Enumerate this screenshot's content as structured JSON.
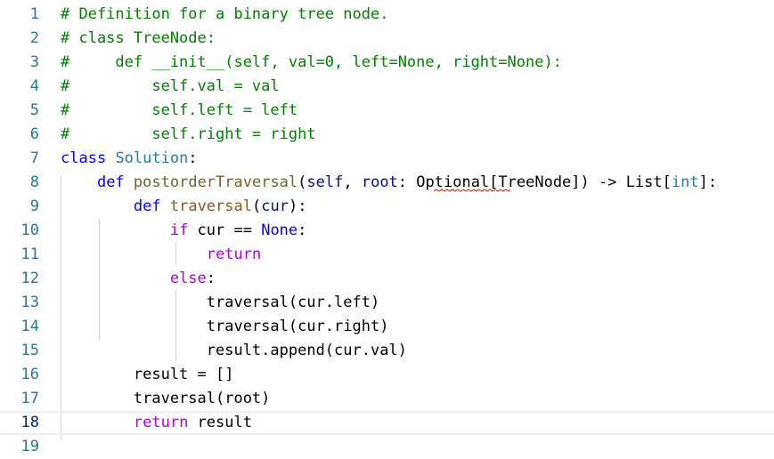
{
  "editor": {
    "language": "python",
    "active_line": 18,
    "colors": {
      "comment": "#008000",
      "keyword": "#0000ff",
      "control_flow": "#af00db",
      "default": "#000000",
      "class": "#267f99",
      "function": "#795e26",
      "parameter": "#001080",
      "line_number": "#237893"
    },
    "lines": [
      {
        "number": "1",
        "tokens": [
          {
            "t": "# Definition for a binary tree node.",
            "c": "comment"
          }
        ]
      },
      {
        "number": "2",
        "tokens": [
          {
            "t": "# class TreeNode:",
            "c": "comment"
          }
        ]
      },
      {
        "number": "3",
        "tokens": [
          {
            "t": "#     def __init__(self, val=0, left=None, right=None):",
            "c": "comment"
          }
        ]
      },
      {
        "number": "4",
        "tokens": [
          {
            "t": "#         self.val = val",
            "c": "comment"
          }
        ]
      },
      {
        "number": "5",
        "tokens": [
          {
            "t": "#         self.left = left",
            "c": "comment"
          }
        ]
      },
      {
        "number": "6",
        "tokens": [
          {
            "t": "#         self.right = right",
            "c": "comment"
          }
        ]
      },
      {
        "number": "7",
        "tokens": [
          {
            "t": "class",
            "c": "keyword"
          },
          {
            "t": " ",
            "c": "default"
          },
          {
            "t": "Solution",
            "c": "class"
          },
          {
            "t": ":",
            "c": "default"
          }
        ]
      },
      {
        "number": "8",
        "tokens": [
          {
            "t": "    ",
            "c": "default"
          },
          {
            "t": "def",
            "c": "keyword"
          },
          {
            "t": " ",
            "c": "default"
          },
          {
            "t": "postorderTraversal",
            "c": "function"
          },
          {
            "t": "(",
            "c": "default"
          },
          {
            "t": "self",
            "c": "parameter"
          },
          {
            "t": ", ",
            "c": "default"
          },
          {
            "t": "root",
            "c": "parameter"
          },
          {
            "t": ": ",
            "c": "default"
          },
          {
            "t": "Optional",
            "c": "default"
          },
          {
            "t": "[TreeNode]) -> List[",
            "c": "default"
          },
          {
            "t": "int",
            "c": "class"
          },
          {
            "t": "]:",
            "c": "default"
          }
        ]
      },
      {
        "number": "9",
        "tokens": [
          {
            "t": "        ",
            "c": "default"
          },
          {
            "t": "def",
            "c": "keyword"
          },
          {
            "t": " ",
            "c": "default"
          },
          {
            "t": "traversal",
            "c": "function"
          },
          {
            "t": "(",
            "c": "default"
          },
          {
            "t": "cur",
            "c": "parameter"
          },
          {
            "t": "):",
            "c": "default"
          }
        ]
      },
      {
        "number": "10",
        "tokens": [
          {
            "t": "            ",
            "c": "default"
          },
          {
            "t": "if",
            "c": "control_flow"
          },
          {
            "t": " cur == ",
            "c": "default"
          },
          {
            "t": "None",
            "c": "keyword"
          },
          {
            "t": ":",
            "c": "default"
          }
        ]
      },
      {
        "number": "11",
        "tokens": [
          {
            "t": "                ",
            "c": "default"
          },
          {
            "t": "return",
            "c": "control_flow"
          }
        ]
      },
      {
        "number": "12",
        "tokens": [
          {
            "t": "            ",
            "c": "default"
          },
          {
            "t": "else",
            "c": "control_flow"
          },
          {
            "t": ":",
            "c": "default"
          }
        ]
      },
      {
        "number": "13",
        "tokens": [
          {
            "t": "                traversal(cur.left)",
            "c": "default"
          }
        ]
      },
      {
        "number": "14",
        "tokens": [
          {
            "t": "                traversal(cur.right)",
            "c": "default"
          }
        ]
      },
      {
        "number": "15",
        "tokens": [
          {
            "t": "                result.append(cur.val)",
            "c": "default"
          }
        ]
      },
      {
        "number": "16",
        "tokens": [
          {
            "t": "        result = []",
            "c": "default"
          }
        ]
      },
      {
        "number": "17",
        "tokens": [
          {
            "t": "        traversal(root)",
            "c": "default"
          }
        ]
      },
      {
        "number": "18",
        "tokens": [
          {
            "t": "        ",
            "c": "default"
          },
          {
            "t": "return",
            "c": "control_flow"
          },
          {
            "t": " result",
            "c": "default"
          }
        ]
      },
      {
        "number": "19",
        "tokens": []
      }
    ]
  }
}
